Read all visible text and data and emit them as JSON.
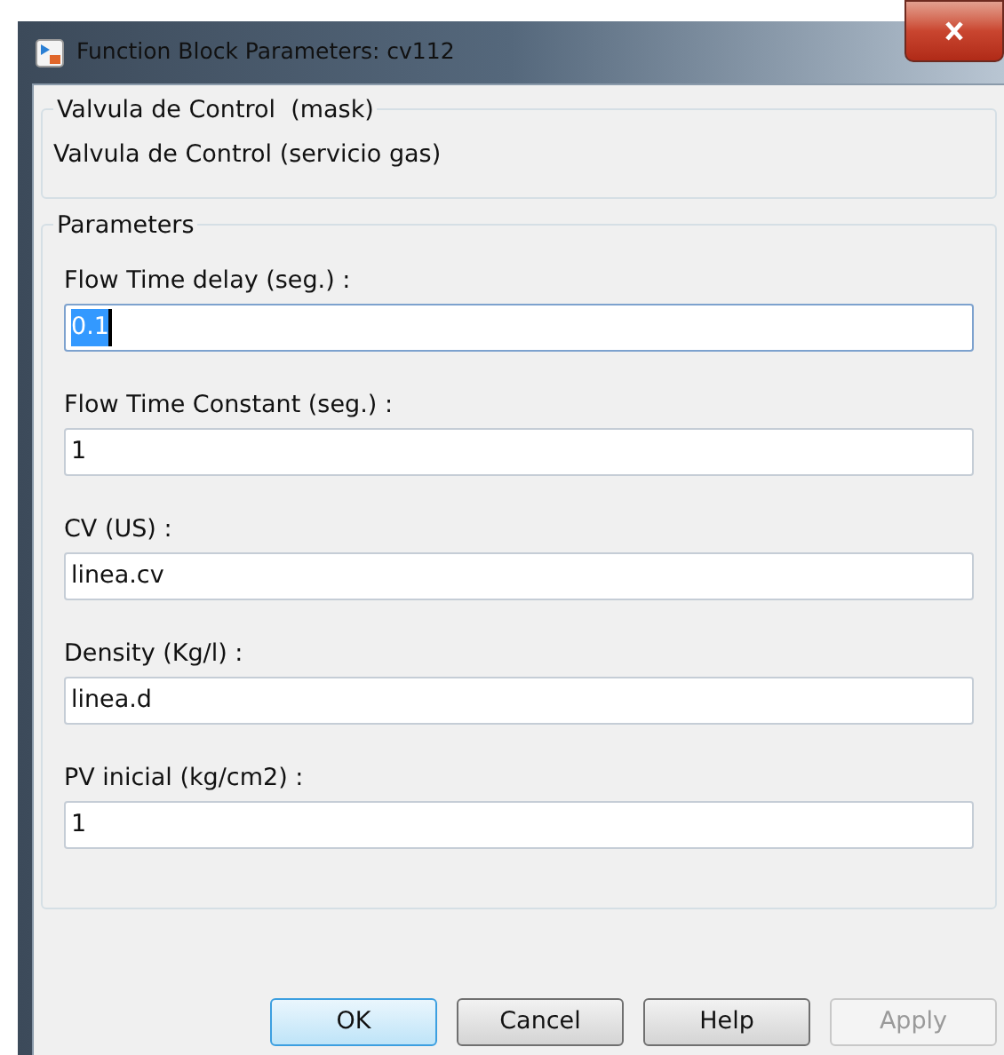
{
  "window": {
    "title": "Function Block Parameters: cv112"
  },
  "mask": {
    "title": "Valvula de Control  (mask)",
    "description": "Valvula de Control (servicio gas)"
  },
  "parameters": {
    "title": "Parameters",
    "fields": [
      {
        "label": "Flow Time delay (seg.) :",
        "value": "0.1",
        "text_selected": true
      },
      {
        "label": "Flow Time Constant (seg.) :",
        "value": "1",
        "text_selected": false
      },
      {
        "label": "CV (US) :",
        "value": "linea.cv",
        "text_selected": false
      },
      {
        "label": "Density (Kg/l) :",
        "value": "linea.d",
        "text_selected": false
      },
      {
        "label": "PV inicial (kg/cm2) :",
        "value": "1",
        "text_selected": false
      }
    ]
  },
  "buttons": [
    {
      "label": "OK",
      "default": true,
      "disabled": false
    },
    {
      "label": "Cancel",
      "default": false,
      "disabled": false
    },
    {
      "label": "Help",
      "default": false,
      "disabled": false
    },
    {
      "label": "Apply",
      "default": false,
      "disabled": true
    }
  ]
}
